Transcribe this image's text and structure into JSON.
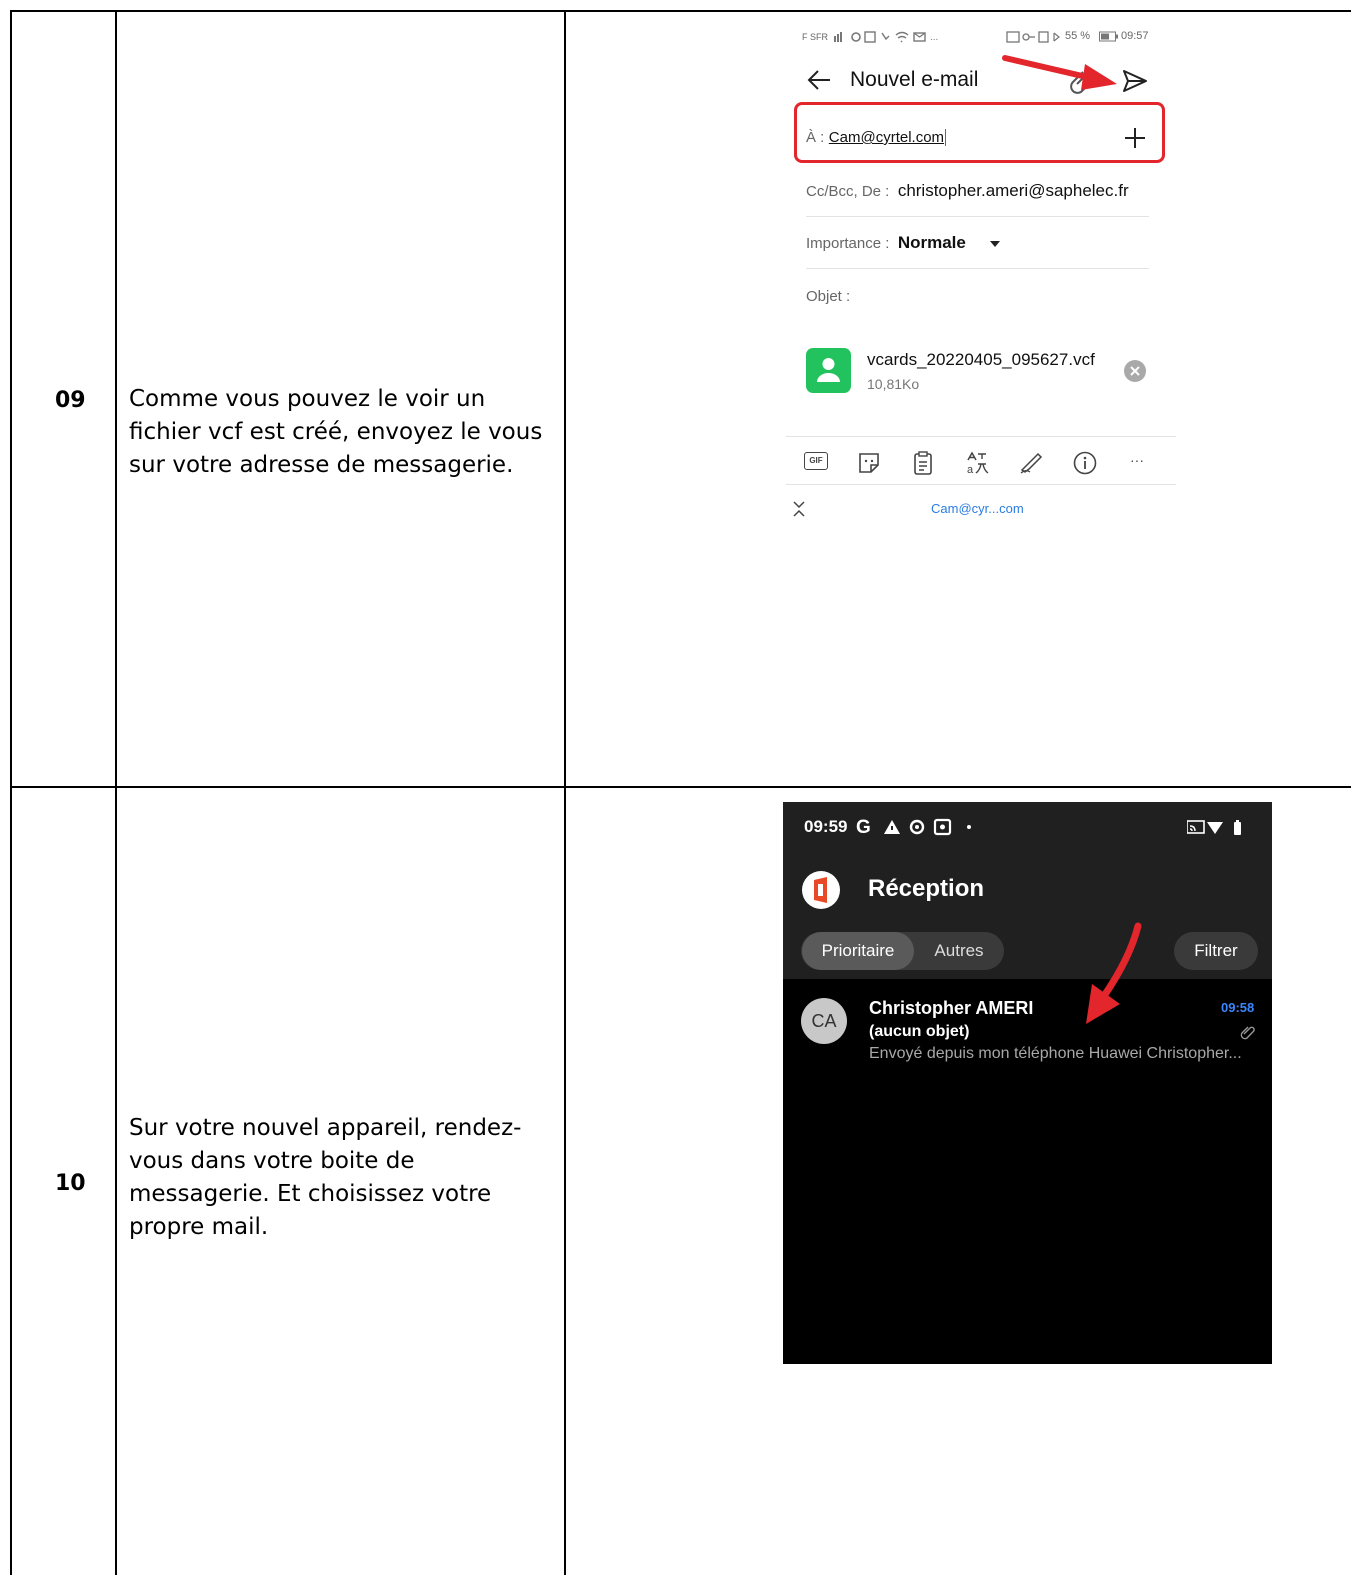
{
  "steps": [
    {
      "number": "09",
      "text": "Comme vous pouvez le voir un fichier vcf est créé, envoyez le vous sur votre adresse de messagerie."
    },
    {
      "number": "10",
      "text": "Sur votre nouvel appareil, rendez-vous dans votre boite de messagerie. Et choisissez votre propre mail."
    }
  ],
  "compose": {
    "status_left": "F SFR",
    "battery": "55 %",
    "time": "09:57",
    "title": "Nouvel e-mail",
    "to_label": "À :",
    "to_value": "Cam@cyrtel.com",
    "cc_label": "Cc/Bcc, De :",
    "cc_value": "christopher.ameri@saphelec.fr",
    "importance_label": "Importance :",
    "importance_value": "Normale",
    "subject_label": "Objet :",
    "attachment_name": "vcards_20220405_095627.vcf",
    "attachment_size": "10,81Ko",
    "gif_label": "GIF",
    "more_label": "···",
    "recipient_chip": "Cam@cyr...com",
    "highlight_color": "#e2262c"
  },
  "inbox": {
    "time": "09:59",
    "title": "Réception",
    "tab_focused": "Prioritaire",
    "tab_other": "Autres",
    "filter": "Filtrer",
    "message": {
      "avatar": "CA",
      "sender": "Christopher AMERI",
      "subject": "(aucun objet)",
      "preview": "Envoyé depuis mon téléphone Huawei Christopher...",
      "time": "09:58"
    },
    "time_color": "#3b87ff",
    "arrow_color": "#e2262c"
  }
}
